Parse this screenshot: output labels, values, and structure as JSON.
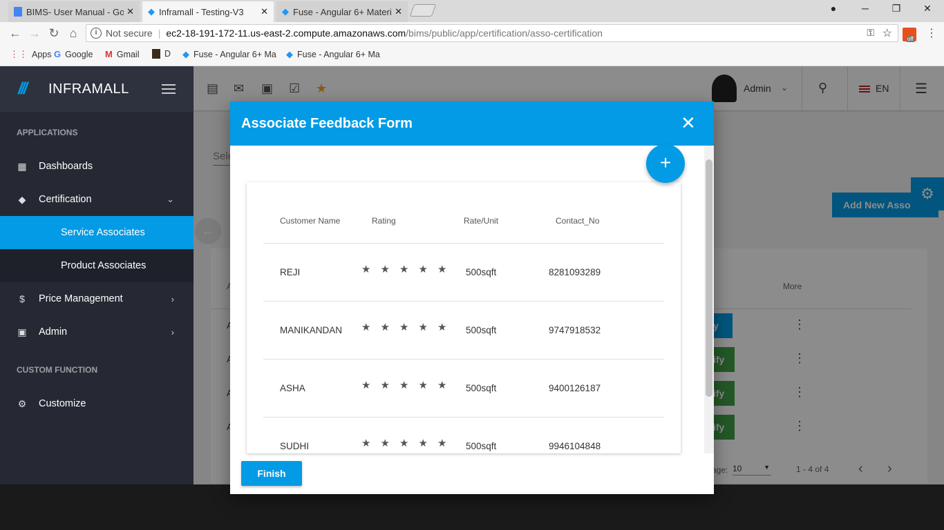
{
  "browser": {
    "tabs": [
      {
        "title": "BIMS- User Manual - Goo",
        "icon": "docs-icon"
      },
      {
        "title": "Inframall - Testing-V3",
        "icon": "angular-icon"
      },
      {
        "title": "Fuse - Angular 6+ Materi",
        "icon": "angular-icon"
      }
    ],
    "close_symbol": "✕",
    "not_secure": "Not secure",
    "url_host": "ec2-18-191-172-11.us-east-2.compute.amazonaws.com",
    "url_path": "/bims/public/app/certification/asso-certification",
    "ext_badge": "off",
    "bookmarks": [
      {
        "label": "Apps"
      },
      {
        "label": "Google"
      },
      {
        "label": "Gmail"
      },
      {
        "label": "D"
      },
      {
        "label": "Fuse - Angular 6+ Ma"
      },
      {
        "label": "Fuse - Angular 6+ Ma"
      }
    ]
  },
  "app": {
    "brand": "INFRAMALL",
    "sections": {
      "applications": "APPLICATIONS",
      "custom": "CUSTOM FUNCTION"
    },
    "nav": {
      "dashboards": "Dashboards",
      "certification": "Certification",
      "service_associates": "Service Associates",
      "product_associates": "Product Associates",
      "price_management": "Price Management",
      "admin": "Admin",
      "customize": "Customize"
    },
    "user": "Admin",
    "language": "EN"
  },
  "background": {
    "select_placeholder": "Sele",
    "add_button": "Add New Associate",
    "more_header": "More",
    "verify_labels": [
      "y",
      "ify",
      "ify",
      "ify"
    ],
    "row_initials": [
      "A",
      "A",
      "A",
      "A",
      "A"
    ],
    "page_label": "age:",
    "page_size": "10",
    "range": "1 - 4 of 4"
  },
  "dialog": {
    "title": "Associate Feedback Form",
    "columns": [
      "Customer Name",
      "Rating",
      "Rate/Unit",
      "Contact_No"
    ],
    "rows": [
      {
        "name": "REJI",
        "rating": 5,
        "rate": "500sqft",
        "contact": "8281093289"
      },
      {
        "name": "MANIKANDAN",
        "rating": 5,
        "rate": "500sqft",
        "contact": "9747918532"
      },
      {
        "name": "ASHA",
        "rating": 5,
        "rate": "500sqft",
        "contact": "9400126187"
      },
      {
        "name": "SUDHI",
        "rating": 5,
        "rate": "500sqft",
        "contact": "9946104848"
      }
    ],
    "finish": "Finish",
    "add_symbol": "+"
  },
  "colors": {
    "accent": "#039be5",
    "sidebar": "#262933",
    "star_active": "#e6a23c"
  }
}
